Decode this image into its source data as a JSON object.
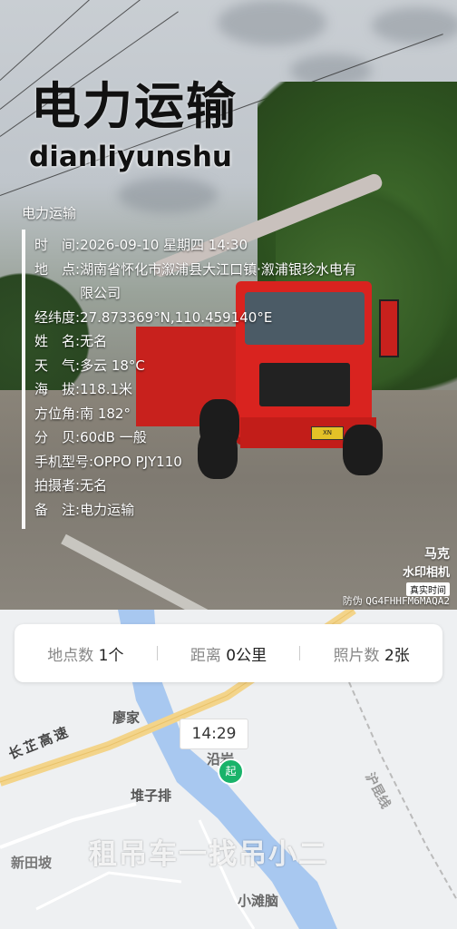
{
  "photo": {
    "title": "电力运输",
    "subtitle": "dianliyunshu",
    "brand_label": "电力运输",
    "info": [
      {
        "key": "时　间:",
        "value": "2026-09-10 星期四 14:30"
      },
      {
        "key": "地　点:",
        "value": "湖南省怀化市溆浦县大江口镇·溆浦银珍水电有限公司"
      },
      {
        "key": "经纬度:",
        "value": "27.873369°N,110.459140°E"
      },
      {
        "key": "姓　名:",
        "value": "无名"
      },
      {
        "key": "天　气:",
        "value": "多云 18°C"
      },
      {
        "key": "海　拔:",
        "value": "118.1米"
      },
      {
        "key": "方位角:",
        "value": "南 182°"
      },
      {
        "key": "分　贝:",
        "value": "60dB 一般"
      },
      {
        "key": "手机型号:",
        "value": "OPPO PJY110"
      },
      {
        "key": "拍摄者:",
        "value": "无名"
      },
      {
        "key": "备　注:",
        "value": "电力运输"
      }
    ],
    "watermark_logo": {
      "line1": "马克",
      "line2": "水印相机",
      "badge": "真实时间"
    },
    "anti_fake": {
      "label": "防伪",
      "code": "QG4FHHFM6MAQA2"
    },
    "truck_plate": "XN 56851"
  },
  "stats": [
    {
      "label": "地点数",
      "value": "1个"
    },
    {
      "label": "距离",
      "value": "0公里"
    },
    {
      "label": "照片数",
      "value": "2张"
    }
  ],
  "map": {
    "time_badge": "14:29",
    "start_pin": "起",
    "labels": {
      "liaojia": "廖家",
      "highway": "长芷高速",
      "duizipai": "堆子排",
      "xintianpo": "新田坡",
      "xiaotannao": "小滩脑",
      "railway": "沪昆线",
      "place": "沿岩"
    },
    "bottom_watermark": "租吊车一找吊小二"
  }
}
